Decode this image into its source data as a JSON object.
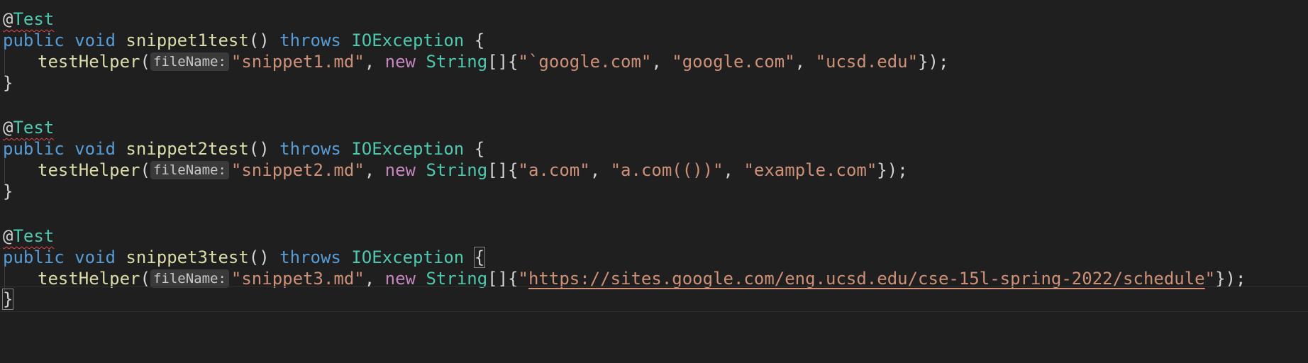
{
  "code": {
    "annotation_at": "@",
    "annotation_name": "Test",
    "kw_public": "public",
    "kw_void": "void",
    "kw_throws": "throws",
    "exception_type": "IOException",
    "open_brace": "{",
    "close_brace": "}",
    "helper_fn": "testHelper",
    "param_hint": "fileName:",
    "kw_new": "new",
    "string_type": "String",
    "array_open": "[]{",
    "tests": [
      {
        "method": "snippet1test",
        "file": "\"snippet1.md\"",
        "args": [
          "\"`google.com\"",
          "\"google.com\"",
          "\"ucsd.edu\""
        ]
      },
      {
        "method": "snippet2test",
        "file": "\"snippet2.md\"",
        "args": [
          "\"a.com\"",
          "\"a.com(())\"",
          "\"example.com\""
        ]
      },
      {
        "method": "snippet3test",
        "file": "\"snippet3.md\"",
        "args": [
          "\"",
          "https://sites.google.com/eng.ucsd.edu/cse-15l-spring-2022/schedule",
          "\""
        ]
      }
    ]
  },
  "colors": {
    "background": "#1f1f1f",
    "keyword": "#569cd6",
    "control_keyword": "#c586c0",
    "type": "#4ec9b0",
    "function": "#dcdcaa",
    "string": "#ce9178"
  }
}
